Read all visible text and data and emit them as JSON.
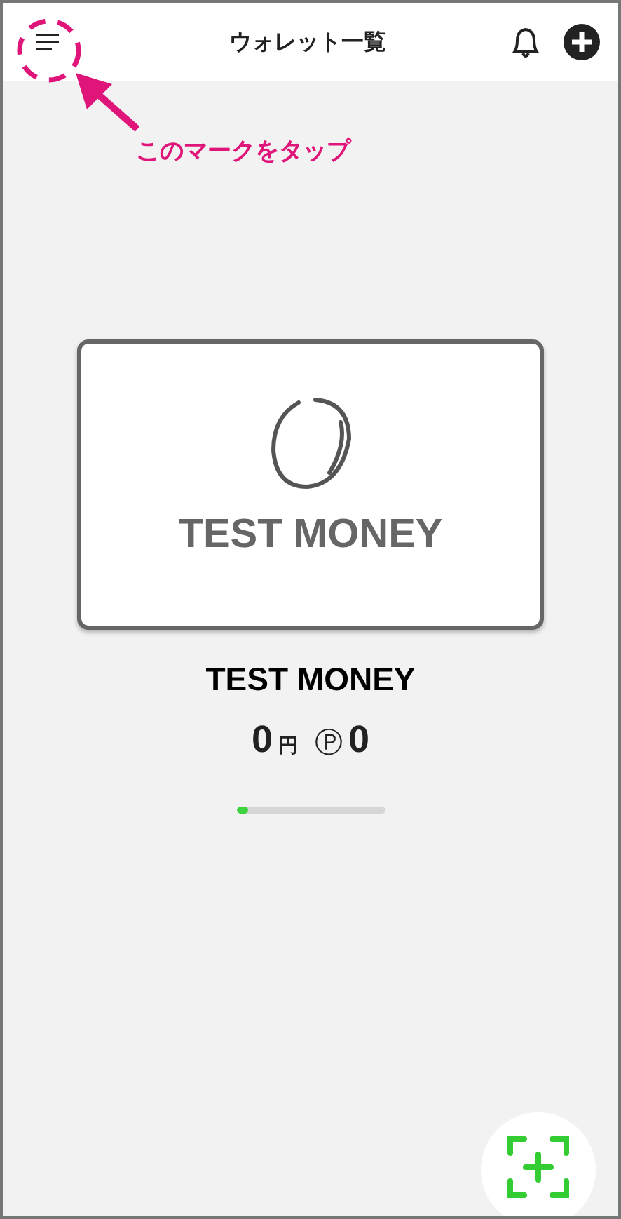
{
  "header": {
    "title": "ウォレット一覧"
  },
  "annotation": {
    "text": "このマークをタップ"
  },
  "wallet": {
    "card_name": "TEST MONEY",
    "name": "TEST MONEY",
    "balance": "0",
    "currency": "円",
    "point_mark": "Ⓟ",
    "points": "0"
  },
  "pager": {
    "level": 0.08
  }
}
